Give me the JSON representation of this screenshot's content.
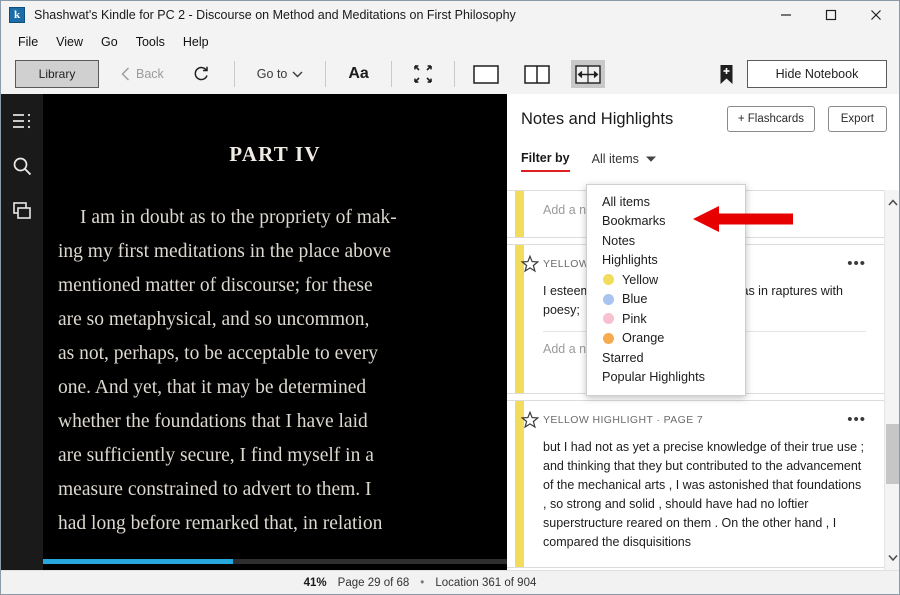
{
  "window": {
    "title": "Shashwat's Kindle for PC 2 - Discourse on Method and Meditations on First Philosophy",
    "app_icon_letter": "k",
    "minimize": "minimize-icon",
    "maximize": "maximize-icon",
    "close": "close-icon"
  },
  "menubar": {
    "items": [
      "File",
      "View",
      "Go",
      "Tools",
      "Help"
    ]
  },
  "toolbar": {
    "library_label": "Library",
    "back_label": "Back",
    "refresh_icon": "sync-icon",
    "goto_label": "Go to",
    "font_label": "Aa",
    "fullscreen_icon": "fullscreen-icon",
    "layout_single_icon": "single-page-icon",
    "layout_double_icon": "two-column-icon",
    "layout_continuous_icon": "fit-width-icon",
    "bookmark_icon": "add-bookmark-icon",
    "hide_notebook_label": "Hide Notebook"
  },
  "sidebar": {
    "items": [
      {
        "icon": "table-of-contents-icon",
        "name": "contents"
      },
      {
        "icon": "search-icon",
        "name": "search"
      },
      {
        "icon": "notebook-icon",
        "name": "notebook"
      }
    ]
  },
  "reader": {
    "part_title": "PART IV",
    "lines": [
      "I am in doubt as to the propriety of mak-",
      "ing my first meditations in the place above",
      "mentioned matter of discourse; for these",
      "are so metaphysical, and so uncommon,",
      "as not, perhaps, to be acceptable to every",
      "one. And yet, that it may be determined",
      "whether the foundations that I have laid",
      "are sufficiently secure, I find myself in a",
      "measure constrained to advert to them. I",
      "had long before remarked that, in relation"
    ],
    "progress_percent": 41
  },
  "notebook": {
    "title": "Notes and Highlights",
    "flashcards_label": "+ Flashcards",
    "export_label": "Export",
    "filter_by_label": "Filter by",
    "filter_value": "All items",
    "cards": [
      {
        "meta": "",
        "text": "",
        "note_placeholder": "Add a note",
        "strip_color": "#f2dc5c",
        "starred": false,
        "partial": true
      },
      {
        "meta": "YELLOW HIGHLIGHT · PAGE 7",
        "text": "I esteemed eloquence highly, and was in raptures with poesy;",
        "note_placeholder": "Add a note",
        "strip_color": "#f2dc5c",
        "starred": false,
        "partial": false
      },
      {
        "meta": "YELLOW HIGHLIGHT · PAGE 7",
        "text": "but I had not as yet a precise knowledge of their true use ; and thinking that they but contributed to the advancement of the mechanical arts , I was astonished that foundations , so strong and solid , should have had no loftier superstructure reared on them . On the other hand , I compared the disquisitions",
        "note_placeholder": "",
        "strip_color": "#f2dc5c",
        "starred": false,
        "partial": false
      }
    ],
    "scrollbar": {
      "up_icon": "chevron-up-icon",
      "down_icon": "chevron-down-icon"
    }
  },
  "filter_menu": {
    "items": [
      {
        "label": "All items",
        "color": null
      },
      {
        "label": "Bookmarks",
        "color": null
      },
      {
        "label": "Notes",
        "color": null
      },
      {
        "label": "Highlights",
        "color": null
      },
      {
        "label": "Yellow",
        "color": "#f2dc5c"
      },
      {
        "label": "Blue",
        "color": "#a8c5ef"
      },
      {
        "label": "Pink",
        "color": "#f9c0d0"
      },
      {
        "label": "Orange",
        "color": "#f5ab4e"
      },
      {
        "label": "Starred",
        "color": null
      },
      {
        "label": "Popular Highlights",
        "color": null
      }
    ]
  },
  "annotation": {
    "arrow_color": "#e60000",
    "points_to": "Bookmarks"
  },
  "statusbar": {
    "percent": "41%",
    "page": "Page 29 of 68",
    "separator": "•",
    "location": "Location 361 of 904"
  },
  "colors": {
    "accent_red": "#e02020",
    "progress_blue": "#26a8df",
    "highlight_yellow": "#f2dc5c",
    "page_bg": "#000000"
  }
}
